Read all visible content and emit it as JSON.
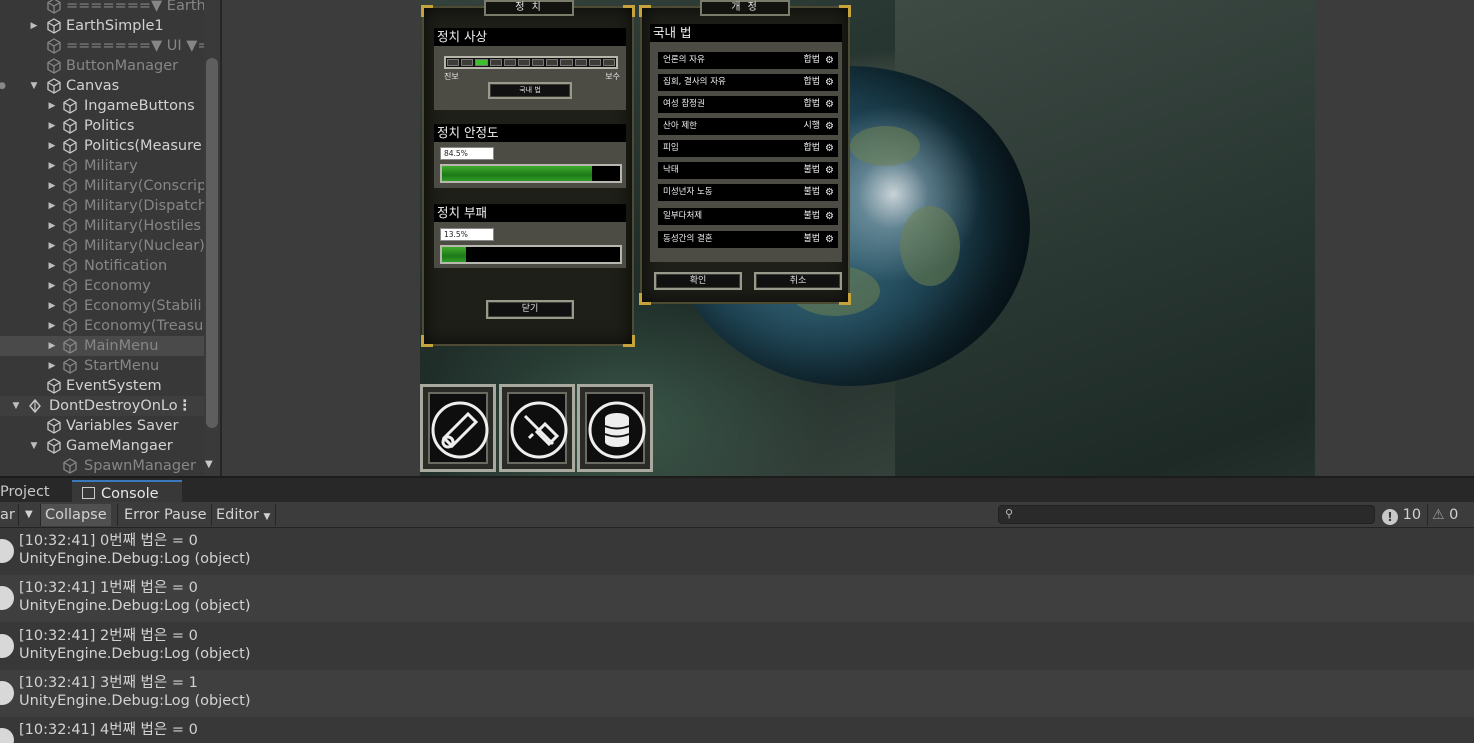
{
  "hierarchy": {
    "items": [
      {
        "label": "=======▼ Earth"
      },
      {
        "label": "EarthSimple1"
      },
      {
        "label": "=======▼ UI ▼="
      },
      {
        "label": "ButtonManager"
      },
      {
        "label": "Canvas"
      },
      {
        "label": "IngameButtons"
      },
      {
        "label": "Politics"
      },
      {
        "label": "Politics(Measure"
      },
      {
        "label": "Military"
      },
      {
        "label": "Military(Conscrip"
      },
      {
        "label": "Military(Dispatch"
      },
      {
        "label": "Military(Hostiles"
      },
      {
        "label": "Military(Nuclear)"
      },
      {
        "label": "Notification"
      },
      {
        "label": "Economy"
      },
      {
        "label": "Economy(Stabili"
      },
      {
        "label": "Economy(Treasu"
      },
      {
        "label": "MainMenu"
      },
      {
        "label": "StartMenu"
      },
      {
        "label": "EventSystem"
      },
      {
        "label": "DontDestroyOnLo"
      },
      {
        "label": "Variables Saver"
      },
      {
        "label": "GameMangaer"
      },
      {
        "label": "SpawnManager"
      }
    ]
  },
  "game": {
    "politics_panel": {
      "title": "정 치",
      "ideology": {
        "heading": "정치 사상",
        "left_label": "진보",
        "right_label": "보수",
        "button": "국내 법",
        "segment_count": 12,
        "active_segment": 3
      },
      "stability": {
        "heading": "정치 안정도",
        "value_text": "84.5%",
        "value": 84.5
      },
      "corruption": {
        "heading": "정치 부패",
        "value_text": "13.5%",
        "value": 13.5
      },
      "close_button": "닫기"
    },
    "reform_panel": {
      "title": "개 정",
      "heading": "국내 법",
      "laws": [
        {
          "name": "언론의 자유",
          "status": "합법"
        },
        {
          "name": "집회, 결사의 자유",
          "status": "합법"
        },
        {
          "name": "여성 참정권",
          "status": "합법"
        },
        {
          "name": "산아 제한",
          "status": "시행"
        },
        {
          "name": "피임",
          "status": "합법"
        },
        {
          "name": "낙태",
          "status": "불법"
        },
        {
          "name": "미성년자 노동",
          "status": "불법"
        },
        {
          "name": "일부다처제",
          "status": "불법"
        },
        {
          "name": "동성간의 결혼",
          "status": "불법"
        }
      ],
      "confirm_button": "확인",
      "cancel_button": "취소"
    },
    "ability_buttons": [
      {
        "icon": "scroll-icon"
      },
      {
        "icon": "syringe-icon"
      },
      {
        "icon": "coin-stack-icon"
      }
    ]
  },
  "tabs": {
    "project": "Project",
    "console": "Console"
  },
  "toolbar": {
    "clear": "ar",
    "collapse": "Collapse",
    "error_pause": "Error Pause",
    "editor": "Editor",
    "error_count": "10",
    "warning_count": "0"
  },
  "console": {
    "logs": [
      {
        "line1": "[10:32:41] 0번째 법은 = 0",
        "line2": "UnityEngine.Debug:Log (object)"
      },
      {
        "line1": "[10:32:41] 1번째 법은 = 0",
        "line2": "UnityEngine.Debug:Log (object)"
      },
      {
        "line1": "[10:32:41] 2번째 법은 = 0",
        "line2": "UnityEngine.Debug:Log (object)"
      },
      {
        "line1": "[10:32:41] 3번째 법은 = 1",
        "line2": "UnityEngine.Debug:Log (object)"
      },
      {
        "line1": "[10:32:41] 4번째 법은 = 0",
        "line2": ""
      }
    ]
  }
}
